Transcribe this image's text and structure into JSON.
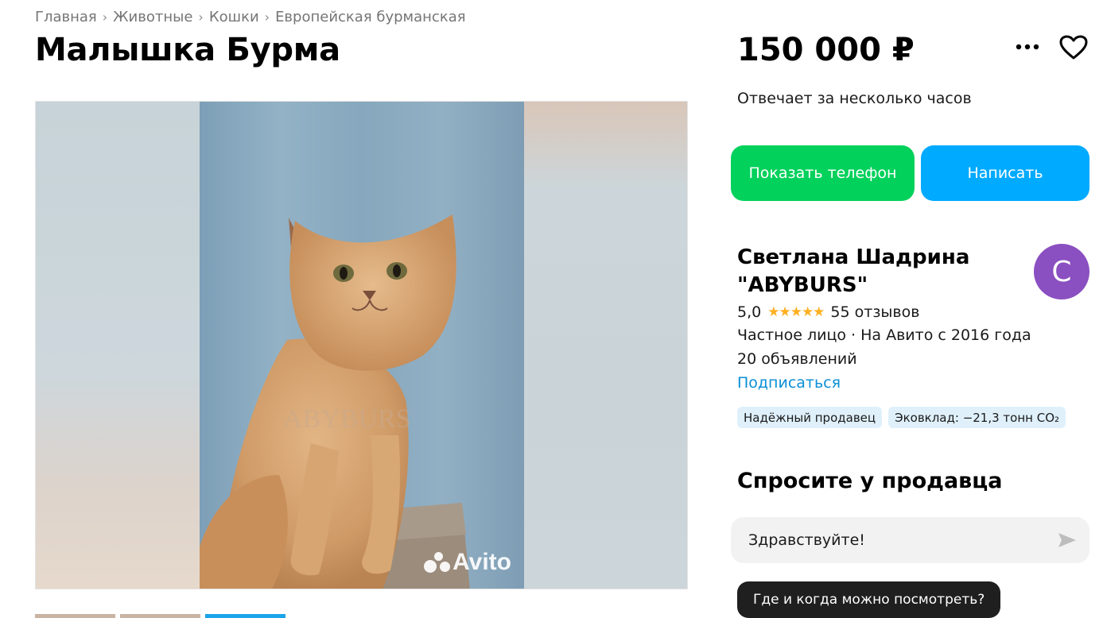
{
  "breadcrumb": {
    "items": [
      "Главная",
      "Животные",
      "Кошки",
      "Европейская бурманская"
    ],
    "separator": "›"
  },
  "listing": {
    "title": "Малышка Бурма",
    "price": "150 000 ₽",
    "response_time": "Отвечает за несколько часов",
    "photo_watermark": "Avito",
    "photo_count_visible": 3,
    "active_photo_index": 2
  },
  "actions": {
    "more_icon": "more-dots-icon",
    "favorite_icon": "heart-icon",
    "show_phone_label": "Показать телефон",
    "write_label": "Написать"
  },
  "seller": {
    "name": "Светлана Шадрина \"ABYBURS\"",
    "avatar_letter": "С",
    "avatar_color": "#8a4fc0",
    "rating": "5,0",
    "stars": "★★★★★",
    "reviews": "55 отзывов",
    "info": "Частное лицо · На Авито с 2016 года",
    "ads": "20 объявлений",
    "subscribe_label": "Подписаться",
    "badges": [
      "Надёжный продавец",
      "Эковклад: −21,3 тонн CO₂"
    ]
  },
  "ask": {
    "title": "Спросите у продавца",
    "message_value": "Здравствуйте!",
    "send_icon": "send-icon",
    "quick_question": "Где и когда можно посмотреть?"
  },
  "colors": {
    "green_button": "#02d15c",
    "blue_button": "#00aaff",
    "link": "#0a8fd6",
    "star": "#ffb021",
    "badge_bg": "#dff0fb"
  }
}
